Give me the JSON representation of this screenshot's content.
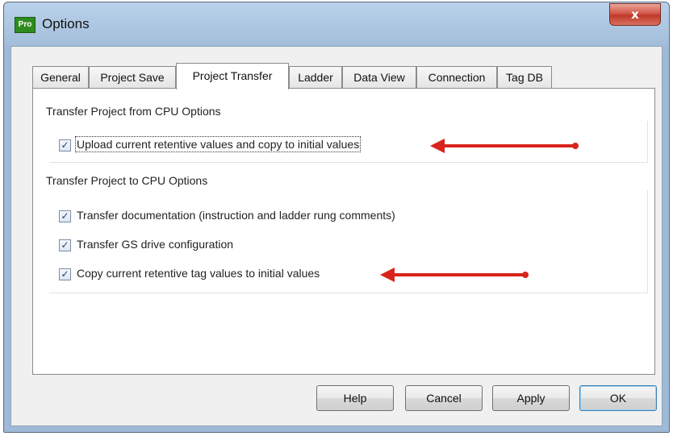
{
  "window": {
    "title": "Options",
    "app_icon_text": "Pro",
    "close_glyph": "x"
  },
  "tabs": [
    {
      "label": "General",
      "active": false
    },
    {
      "label": "Project Save",
      "active": false
    },
    {
      "label": "Project Transfer",
      "active": true
    },
    {
      "label": "Ladder",
      "active": false
    },
    {
      "label": "Data View",
      "active": false
    },
    {
      "label": "Connection",
      "active": false
    },
    {
      "label": "Tag DB",
      "active": false
    }
  ],
  "groups": {
    "from_cpu": {
      "title": "Transfer Project from CPU Options",
      "options": [
        {
          "label": "Upload current retentive values and copy to initial values",
          "checked": true
        }
      ]
    },
    "to_cpu": {
      "title": "Transfer Project to CPU Options",
      "options": [
        {
          "label": "Transfer documentation (instruction and ladder rung comments)",
          "checked": true
        },
        {
          "label": "Transfer GS drive configuration",
          "checked": true
        },
        {
          "label": "Copy current retentive tag values to initial values",
          "checked": true
        }
      ]
    }
  },
  "buttons": {
    "help": "Help",
    "cancel": "Cancel",
    "apply": "Apply",
    "ok": "OK"
  },
  "check_glyph": "✓",
  "colors": {
    "annotation_arrow": "#d9241b",
    "close_button": "#c0392b",
    "app_icon": "#2e8b1f"
  }
}
